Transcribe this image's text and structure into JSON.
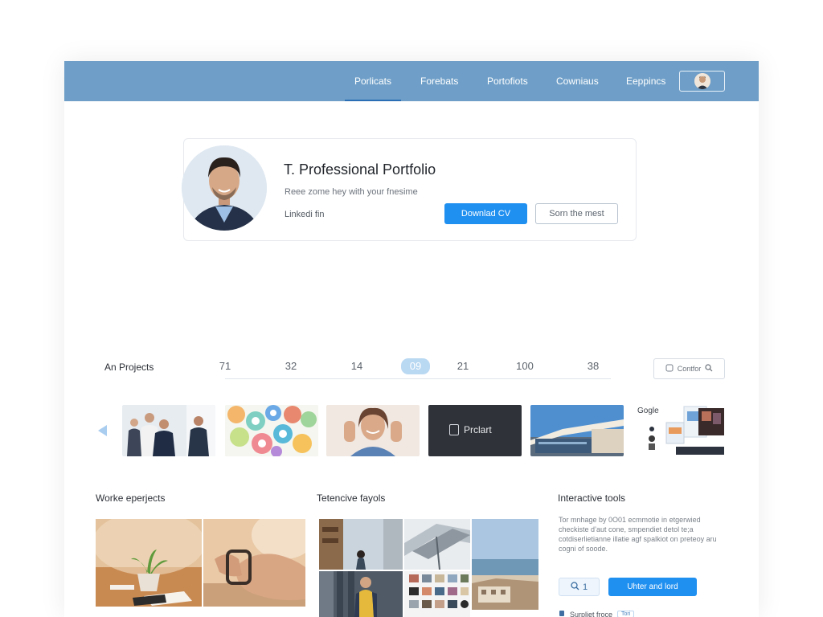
{
  "nav": {
    "items": [
      {
        "label": "Porlicats",
        "active": true
      },
      {
        "label": "Forebats",
        "active": false
      },
      {
        "label": "Portofiots",
        "active": false
      },
      {
        "label": "Cowniaus",
        "active": false
      },
      {
        "label": "Eeppincs",
        "active": false
      }
    ],
    "avatar_icon": "user-avatar-icon"
  },
  "profile": {
    "title": "T. Professional Portfolio",
    "subtitle": "Reee zome hey with your fnesime",
    "link": "Linkedi fin",
    "primary_button": "Downlad CV",
    "secondary_button": "Sorn the mest"
  },
  "projects": {
    "label": "An Projects",
    "counts": [
      "71",
      "32",
      "14",
      "09",
      "21",
      "100",
      "38"
    ],
    "active_index": 3,
    "filter_label": "Contfor",
    "filter_icon": "search-icon"
  },
  "carousel": {
    "prev_icon": "chevron-left-icon",
    "thumbnails": [
      {
        "kind": "team-photo"
      },
      {
        "kind": "icons-collage"
      },
      {
        "kind": "portrait-photo"
      },
      {
        "kind": "dark-card",
        "text": "Prclart"
      },
      {
        "kind": "building-photo"
      },
      {
        "kind": "devices-collage",
        "text": "Gogle"
      }
    ]
  },
  "sections": {
    "works": {
      "title": "Worke eperjects"
    },
    "featured": {
      "title": "Tetencive fayols"
    },
    "tools": {
      "title": "Interactive tools",
      "text": "Tor mnhage by 0O01 ecmmotie in etgerwied checkiste d’aut cone, smpendiet detol te;a cotdiserlietianne illatie agf spalkiot on preteoy aru cogni of soode.",
      "search_count": "1",
      "button": "Uhter and lord",
      "footer_label": "Surpliet froce",
      "footer_tag": "Tori"
    }
  },
  "colors": {
    "nav_bg": "#6f9fc8",
    "primary": "#1f8ff0",
    "active_count": "#b9d8f2"
  }
}
